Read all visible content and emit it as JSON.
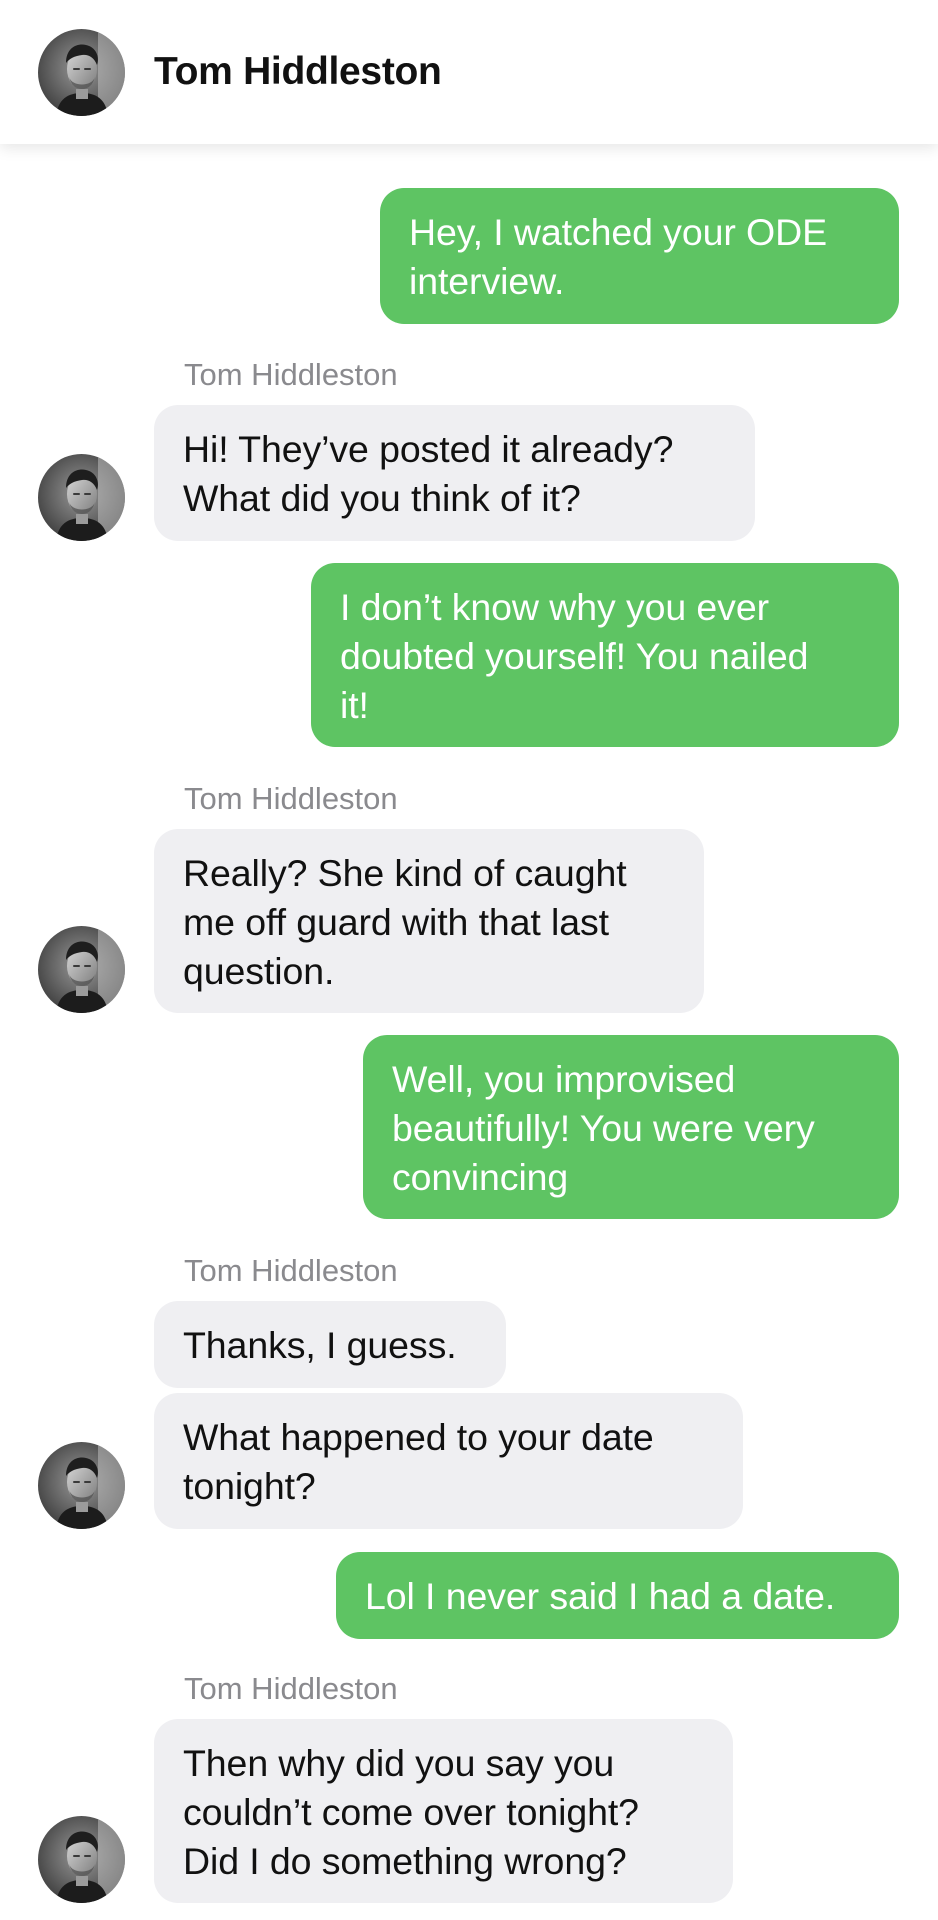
{
  "header": {
    "title": "Tom Hiddleston",
    "avatar_icon": "profile-photo-icon"
  },
  "colors": {
    "outgoing_bubble": "#5ec463",
    "incoming_bubble": "#efeff2",
    "sender_label": "#8a8a8e"
  },
  "messages": [
    {
      "direction": "outgoing",
      "text": "Hey, I watched your ODE\ninterview."
    },
    {
      "direction": "incoming",
      "sender": "Tom Hiddleston",
      "text": "Hi! They’ve posted it already?\nWhat did you think of it?"
    },
    {
      "direction": "outgoing",
      "text": "I don’t know why you ever\ndoubted yourself! You nailed\nit!"
    },
    {
      "direction": "incoming",
      "sender": "Tom Hiddleston",
      "text": "Really? She kind of caught\nme off guard with that last\nquestion."
    },
    {
      "direction": "outgoing",
      "text": "Well, you improvised\nbeautifully! You were very\nconvincing"
    },
    {
      "direction": "incoming",
      "sender": "Tom Hiddleston",
      "text": "Thanks, I guess."
    },
    {
      "direction": "incoming",
      "text": "What happened to your date\ntonight?"
    },
    {
      "direction": "outgoing",
      "text": "Lol I never said I had a date."
    },
    {
      "direction": "incoming",
      "sender": "Tom Hiddleston",
      "text": "Then why did you say you\ncouldn’t come over tonight?\nDid I do something wrong?"
    }
  ]
}
